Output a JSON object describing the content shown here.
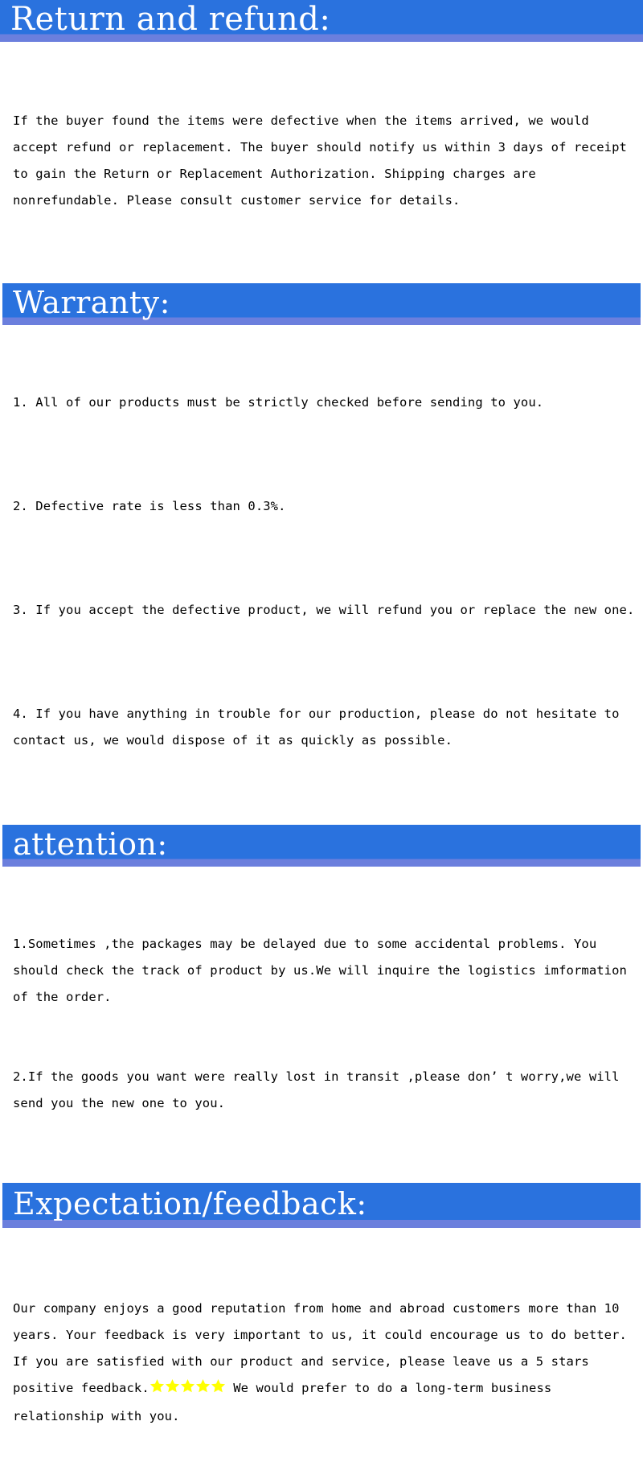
{
  "page": {
    "background": "#ffffff",
    "accent_blue": "#2a72de",
    "accent_blue_light": "#6b7fdd",
    "text_color": "#000000",
    "star_color": "#ffff00"
  },
  "sections": [
    {
      "id": "return-and-refund",
      "heading": "Return and refund:",
      "paragraphs": [
        "If the buyer found the items were defective when the items arrived, we would accept refund or replacement. The buyer should notify us within 3 days of receipt to gain the Return or Replacement Authorization. Shipping charges are nonrefundable. Please consult customer service for details."
      ]
    },
    {
      "id": "warranty",
      "heading": "Warranty:",
      "items": [
        "1. All of our products must be strictly checked before sending to you.",
        "2. Defective rate is less than 0.3%.",
        "3. If you accept the defective product, we will refund you or replace the new one.",
        "4. If you have anything in trouble for our production, please do not hesitate to contact us, we would dispose of it as quickly as possible."
      ]
    },
    {
      "id": "attention",
      "heading": "attention:",
      "items": [
        "1.Sometimes ,the packages may be delayed due to some accidental problems. You should check the track of product by us.We will inquire the logistics imformation of the order.",
        "2.If the goods you want were really lost in transit ,please don’ t worry,we will send you the new one to you."
      ]
    },
    {
      "id": "expectation-feedback",
      "heading": "Expectation/feedback:",
      "text_before_stars": "Our company enjoys a good reputation from home and abroad customers more than 10 years. Your feedback is very important to us, it could encourage us to do better. If you are satisfied with our product and service, please leave us a 5 stars positive feedback.",
      "star_count": 5,
      "text_after_stars": " We would prefer to do a long-term business relationship with you."
    }
  ]
}
